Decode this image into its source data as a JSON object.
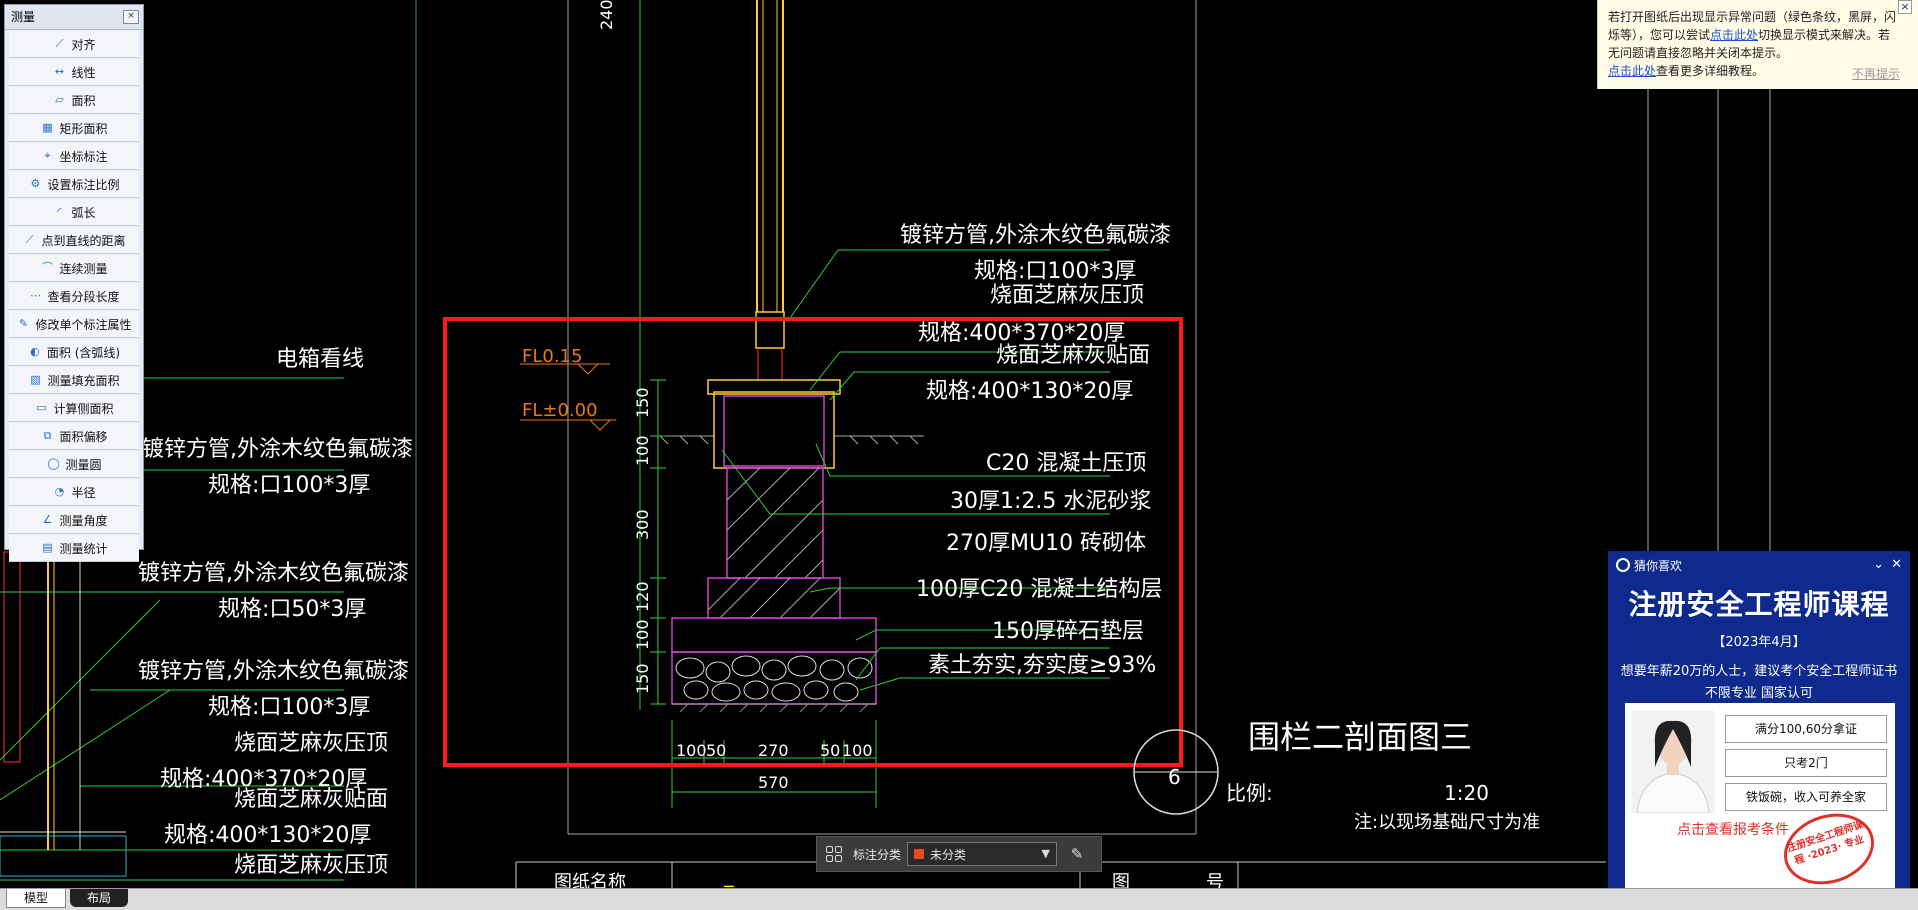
{
  "measure_panel": {
    "title": "测量",
    "close": "×",
    "items": [
      {
        "label": "对齐",
        "icon": "align-icon"
      },
      {
        "label": "线性",
        "icon": "linear-icon"
      },
      {
        "label": "面积",
        "icon": "area-icon"
      },
      {
        "label": "矩形面积",
        "icon": "rect-area-icon"
      },
      {
        "label": "坐标标注",
        "icon": "coordinate-icon"
      },
      {
        "label": "设置标注比例",
        "icon": "scale-icon"
      },
      {
        "label": "弧长",
        "icon": "arc-icon"
      },
      {
        "label": "点到直线的距离",
        "icon": "point-line-icon"
      },
      {
        "label": "连续测量",
        "icon": "continuous-icon"
      },
      {
        "label": "查看分段长度",
        "icon": "segment-icon"
      },
      {
        "label": "修改单个标注属性",
        "icon": "edit-annotation-icon"
      },
      {
        "label": "面积 (含弧线)",
        "icon": "arc-area-icon"
      },
      {
        "label": "测量填充面积",
        "icon": "fill-area-icon"
      },
      {
        "label": "计算侧面积",
        "icon": "side-area-icon"
      },
      {
        "label": "面积偏移",
        "icon": "area-offset-icon"
      },
      {
        "label": "测量圆",
        "icon": "circle-icon"
      },
      {
        "label": "半径",
        "icon": "radius-icon"
      },
      {
        "label": "测量角度",
        "icon": "angle-icon"
      },
      {
        "label": "测量统计",
        "icon": "stats-icon"
      }
    ]
  },
  "notice": {
    "line1": "若打开图纸后出现显示异常问题（绿色条纹，黑屏，闪",
    "line2a": "烁等），您可以尝试",
    "link1": "点击此处",
    "line2b": "切换显示模式来解决。若",
    "line3": "无问题请直接忽略并关闭本提示。",
    "link2": "点击此处",
    "line4": "查看更多详细教程。",
    "dismiss": "不再提示",
    "close": "×"
  },
  "ad": {
    "header": "猜你喜欢",
    "title": "注册安全工程师课程",
    "date": "【2023年4月】",
    "sub1": "想要年薪20万的人士，建议考个安全工程师证书",
    "sub2": "不限专业 国家认可",
    "rows": [
      "满分100,60分拿证",
      "只考2门",
      "铁饭碗，收入可养全家"
    ],
    "cta": "点击查看报考条件",
    "stamp": "注册安全工程师课程 ·2023· 专业"
  },
  "tabs": {
    "model": "模型",
    "layout": "布局"
  },
  "annotation_bar": {
    "label": "标注分类",
    "selected": "未分类",
    "swatch_color": "#e84b1c"
  },
  "drawing": {
    "fl1": "FL0.15",
    "fl2": "FL±0.00",
    "dims_vertical": [
      "150",
      "100",
      "300",
      "120",
      "100",
      "150"
    ],
    "dims_bottom": [
      "100",
      "50",
      "270",
      "50",
      "100"
    ],
    "dim_total": "570",
    "callouts": [
      "镀锌方管,外涂木纹色氟碳漆",
      "规格:口100*3厚",
      "烧面芝麻灰压顶",
      "规格:400*370*20厚",
      "烧面芝麻灰贴面",
      "规格:400*130*20厚",
      "C20 混凝土压顶",
      "30厚1:2.5 水泥砂浆",
      "270厚MU10 砖砌体",
      "100厚C20 混凝土结构层",
      "150厚碎石垫层",
      "素土夯实,夯实度≥93%"
    ],
    "section_title": "围栏二剖面图三",
    "section_number": "6",
    "scale_label": "比例:",
    "scale_value": "1:20",
    "note": "注:以现场基础尺寸为准",
    "left_labels": [
      "电箱看线",
      "镀锌方管,外涂木纹色氟碳漆",
      "规格:口100*3厚",
      "镀锌方管,外涂木纹色氟碳漆",
      "规格:口50*3厚",
      "镀锌方管,外涂木纹色氟碳漆",
      "规格:口100*3厚",
      "烧面芝麻灰压顶",
      "规格:400*370*20厚",
      "烧面芝麻灰贴面",
      "规格:400*130*20厚",
      "烧面芝麻灰压顶"
    ],
    "top_dim": "240",
    "table_label1": "图纸名称",
    "table_label2": "图",
    "table_label3": "号"
  }
}
